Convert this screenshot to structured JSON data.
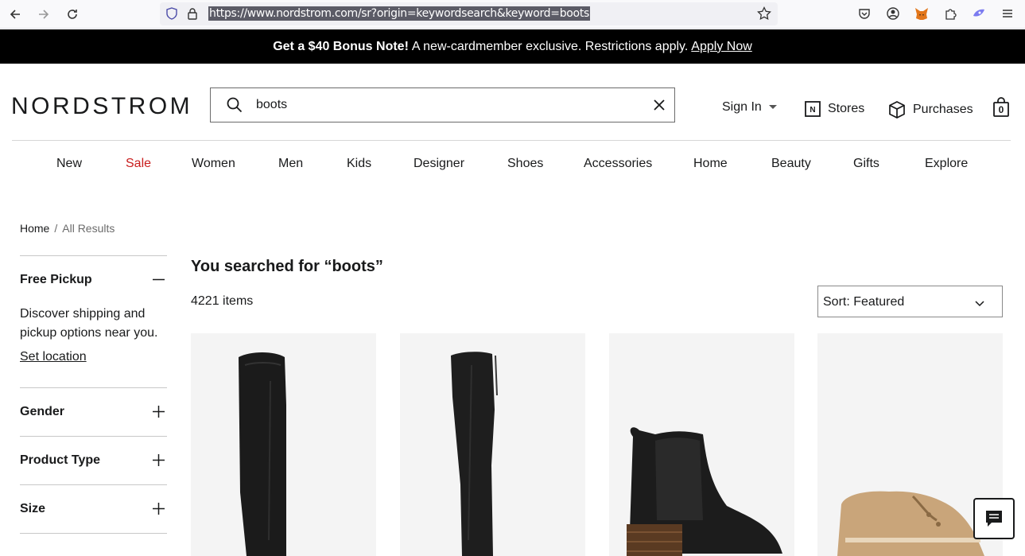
{
  "browser": {
    "url": "https://www.nordstrom.com/sr?origin=keywordsearch&keyword=boots"
  },
  "banner": {
    "bold": "Get a $40 Bonus Note!",
    "text": "A new-cardmember exclusive. Restrictions apply.",
    "link": "Apply Now"
  },
  "header": {
    "logo": "NORDSTROM",
    "search_value": "boots",
    "sign_in": "Sign In",
    "stores": "Stores",
    "purchases": "Purchases",
    "bag_count": "0"
  },
  "nav": {
    "items": [
      "New",
      "Sale",
      "Women",
      "Men",
      "Kids",
      "Designer",
      "Shoes",
      "Accessories",
      "Home",
      "Beauty",
      "Gifts",
      "Explore"
    ]
  },
  "breadcrumb": {
    "home": "Home",
    "sep": "/",
    "current": "All Results"
  },
  "filters": {
    "pickup_title": "Free Pickup",
    "pickup_desc": "Discover shipping and pickup options near you.",
    "set_location": "Set location",
    "gender": "Gender",
    "product_type": "Product Type",
    "size": "Size"
  },
  "results": {
    "title": "You searched for “boots”",
    "count": "4221 items",
    "sort": "Sort: Featured"
  },
  "colors": {
    "sale": "#c91d1d",
    "banner_bg": "#000000",
    "card_bg": "#f4f4f4"
  }
}
